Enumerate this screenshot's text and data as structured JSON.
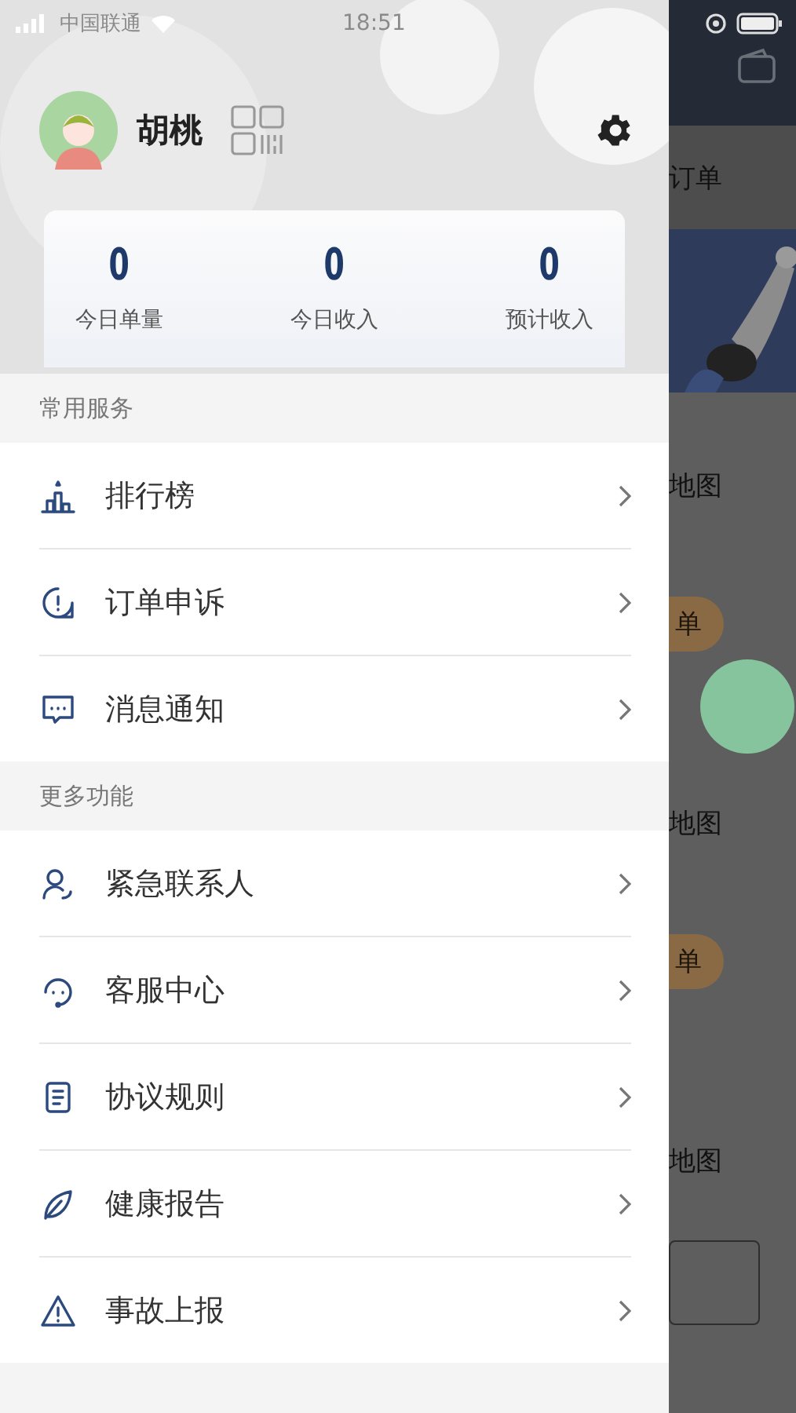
{
  "status_bar": {
    "carrier": "中国联通",
    "time": "18:51"
  },
  "profile": {
    "name": "胡桃"
  },
  "stats": [
    {
      "value": "0",
      "label": "今日单量"
    },
    {
      "value": "0",
      "label": "今日收入"
    },
    {
      "value": "0",
      "label": "预计收入"
    }
  ],
  "sections": [
    {
      "title": "常用服务",
      "items": [
        {
          "label": "排行榜"
        },
        {
          "label": "订单申诉"
        },
        {
          "label": "消息通知"
        }
      ]
    },
    {
      "title": "更多功能",
      "items": [
        {
          "label": "紧急联系人"
        },
        {
          "label": "客服中心"
        },
        {
          "label": "协议规则"
        },
        {
          "label": "健康报告"
        },
        {
          "label": "事故上报"
        }
      ]
    }
  ],
  "background_app": {
    "header_text": "订单",
    "rows": [
      {
        "kind": "text",
        "text": "地图"
      },
      {
        "kind": "button",
        "text": "单"
      },
      {
        "kind": "text",
        "text": "地图"
      },
      {
        "kind": "button",
        "text": "单"
      },
      {
        "kind": "text",
        "text": "地图"
      }
    ]
  }
}
